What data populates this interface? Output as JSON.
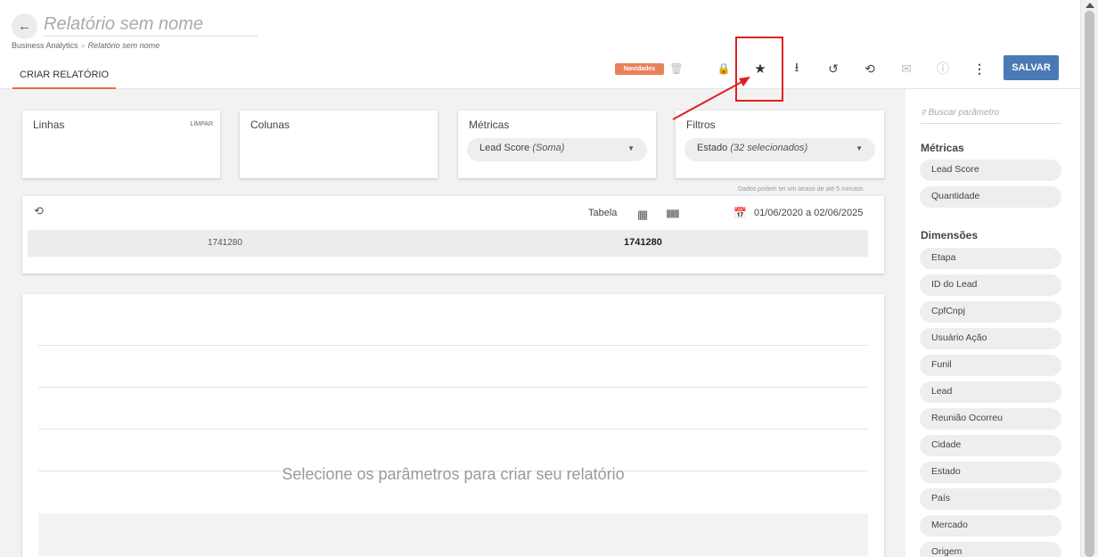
{
  "header": {
    "back_icon": "arrow-left-icon",
    "title": "Relatório sem nome",
    "breadcrumb": {
      "root": "Business Analytics",
      "current": "Relatório sem nome"
    },
    "tab_label": "CRIAR RELATÓRIO"
  },
  "toolbar": {
    "badge": "Novidades",
    "icons": {
      "trash": "🗑",
      "lock": "🔒",
      "star": "★",
      "download": "⭳",
      "history": "↺",
      "sync": "⟲",
      "mail": "✉",
      "info": "ⓘ",
      "more": "⋮"
    },
    "save_label": "SALVAR"
  },
  "panels": {
    "linhas": {
      "title": "Linhas",
      "clear_label": "LIMPAR"
    },
    "colunas": {
      "title": "Colunas"
    },
    "metricas": {
      "title": "Métricas",
      "chip": "Lead Score",
      "chip_sub": "(Soma)"
    },
    "filtros": {
      "title": "Filtros",
      "chip": "Estado",
      "chip_sub": "(32 selecionados)"
    },
    "delay_note": "Dados podem ter um atraso de até 5 minutos"
  },
  "table": {
    "view_label": "Tabela",
    "date_range": "01/06/2020 a 02/06/2025",
    "row": {
      "left": "1741280",
      "right": "1741280"
    }
  },
  "empty_state": {
    "message": "Selecione os parâmetros para criar seu relatório"
  },
  "sidebar": {
    "search_placeholder": "Buscar parâmetro",
    "metricas_title": "Métricas",
    "metricas": [
      "Lead Score",
      "Quantidade"
    ],
    "dimensoes_title": "Dimensões",
    "dimensoes": [
      "Etapa",
      "ID do Lead",
      "CpfCnpj",
      "Usuário Ação",
      "Funil",
      "Lead",
      "Reunião Ocorreu",
      "Cidade",
      "Estado",
      "País",
      "Mercado",
      "Origem"
    ]
  },
  "colors": {
    "accent": "#e86a45",
    "save_button": "#4a7ab5",
    "annotation": "#e02020"
  }
}
